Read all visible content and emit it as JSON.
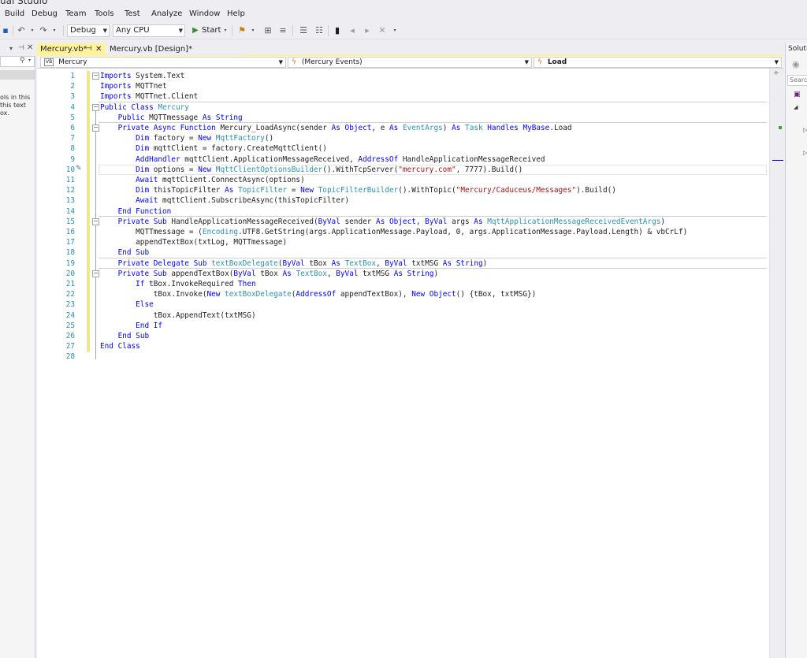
{
  "window": {
    "title": "ual Studio"
  },
  "menu": [
    "Build",
    "Debug",
    "Team",
    "Tools",
    "Test",
    "Analyze",
    "Window",
    "Help"
  ],
  "toolbar": {
    "config": "Debug",
    "platform": "Any CPU",
    "start_label": "Start"
  },
  "left_panel": {
    "text_lines": [
      "ols in this",
      "this text",
      "ox."
    ]
  },
  "tabs": [
    {
      "label": "Mercury.vb*",
      "active": true
    },
    {
      "label": "Mercury.vb [Design]*",
      "active": false
    }
  ],
  "navbar": {
    "project": "Mercury",
    "events": "(Mercury Events)",
    "member": "Load",
    "project_icon": "VB"
  },
  "right_panel": {
    "title": "Solutio",
    "search": "Searc"
  },
  "code": [
    {
      "n": "1",
      "text": "Imports System.Text"
    },
    {
      "n": "2",
      "text": "Imports MQTTnet"
    },
    {
      "n": "3",
      "text": "Imports MQTTnet.Client"
    },
    {
      "n": "4",
      "text": "Public Class Mercury"
    },
    {
      "n": "5",
      "text": "    Public MQTTmessage As String"
    },
    {
      "n": "6",
      "text": "    Private Async Function Mercury_LoadAsync(sender As Object, e As EventArgs) As Task Handles MyBase.Load"
    },
    {
      "n": "7",
      "text": "        Dim factory = New MqttFactory()"
    },
    {
      "n": "8",
      "text": "        Dim mqttClient = factory.CreateMqttClient()"
    },
    {
      "n": "9",
      "text": "        AddHandler mqttClient.ApplicationMessageReceived, AddressOf HandleApplicationMessageReceived"
    },
    {
      "n": "10",
      "text": "        Dim options = New MqttClientOptionsBuilder().WithTcpServer(\"mercury.com\", 7777).Build()"
    },
    {
      "n": "11",
      "text": "        Await mqttClient.ConnectAsync(options)"
    },
    {
      "n": "12",
      "text": "        Dim thisTopicFilter As TopicFilter = New TopicFilterBuilder().WithTopic(\"Mercury/Caduceus/Messages\").Build()"
    },
    {
      "n": "13",
      "text": "        Await mqttClient.SubscribeAsync(thisTopicFilter)"
    },
    {
      "n": "14",
      "text": "    End Function"
    },
    {
      "n": "15",
      "text": "    Private Sub HandleApplicationMessageReceived(ByVal sender As Object, ByVal args As MqttApplicationMessageReceivedEventArgs)"
    },
    {
      "n": "16",
      "text": "        MQTTmessage = (Encoding.UTF8.GetString(args.ApplicationMessage.Payload, 0, args.ApplicationMessage.Payload.Length) & vbCrLf)"
    },
    {
      "n": "17",
      "text": "        appendTextBox(txtLog, MQTTmessage)"
    },
    {
      "n": "18",
      "text": "    End Sub"
    },
    {
      "n": "19",
      "text": "    Private Delegate Sub textBoxDelegate(ByVal tBox As TextBox, ByVal txtMSG As String)"
    },
    {
      "n": "20",
      "text": "    Private Sub appendTextBox(ByVal tBox As TextBox, ByVal txtMSG As String)"
    },
    {
      "n": "21",
      "text": "        If tBox.InvokeRequired Then"
    },
    {
      "n": "22",
      "text": "            tBox.Invoke(New textBoxDelegate(AddressOf appendTextBox), New Object() {tBox, txtMSG})"
    },
    {
      "n": "23",
      "text": "        Else"
    },
    {
      "n": "24",
      "text": "            tBox.AppendText(txtMSG)"
    },
    {
      "n": "25",
      "text": "        End If"
    },
    {
      "n": "26",
      "text": "    End Sub"
    },
    {
      "n": "27",
      "text": "End Class"
    },
    {
      "n": "28",
      "text": ""
    }
  ],
  "colors": {
    "keyword": "#0000ff",
    "type": "#2b91af",
    "string": "#a31515",
    "tab_active": "#fff29d"
  }
}
